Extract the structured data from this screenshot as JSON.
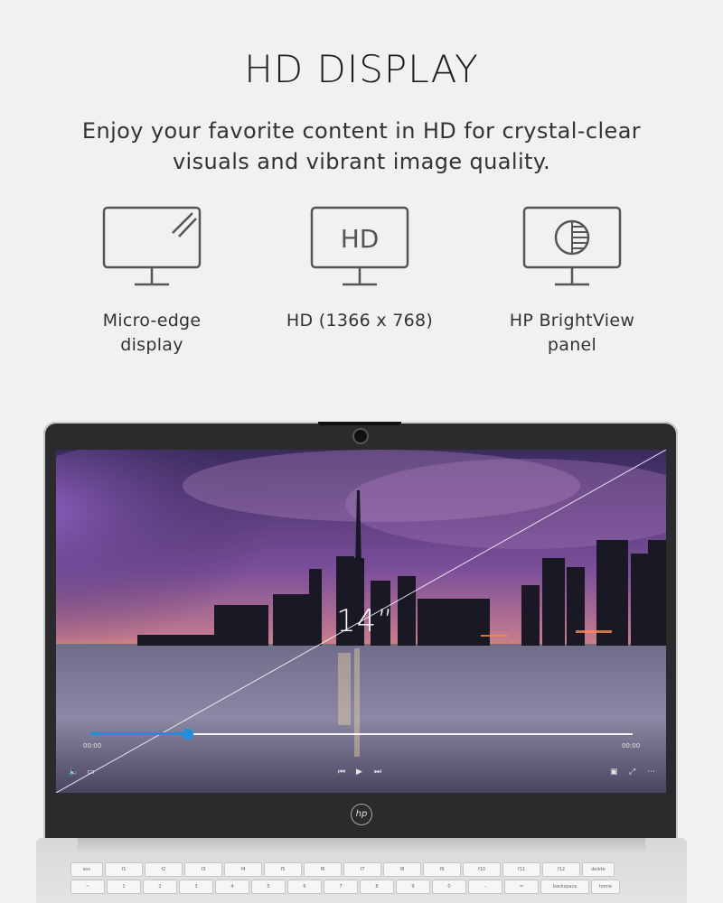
{
  "header": {
    "title": "HD DISPLAY",
    "subtitle_line1": "Enjoy your favorite content in HD for crystal-clear",
    "subtitle_line2": "visuals and vibrant image quality."
  },
  "features": [
    {
      "icon": "monitor-micro-edge-icon",
      "label_line1": "Micro-edge",
      "label_line2": "display"
    },
    {
      "icon": "monitor-hd-icon",
      "icon_text": "HD",
      "label_line1": "HD (1366 x 768)",
      "label_line2": ""
    },
    {
      "icon": "monitor-brightview-icon",
      "label_line1": "HP BrightView",
      "label_line2": "panel"
    }
  ],
  "screen": {
    "size_label": "14”",
    "player": {
      "time_current": "00:00",
      "time_total": "00:00",
      "progress": 0.18
    }
  },
  "laptop": {
    "brand_logo": "hp",
    "keys_row1": [
      "esc",
      "f1",
      "f2",
      "f3",
      "f4",
      "f5",
      "f6",
      "f7",
      "f8",
      "f9",
      "f10",
      "f11",
      "f12",
      "delete"
    ],
    "keys_row2": [
      "~",
      "1",
      "2",
      "3",
      "4",
      "5",
      "6",
      "7",
      "8",
      "9",
      "0",
      "-",
      "=",
      "backspace",
      "home"
    ]
  },
  "colors": {
    "background": "#f1f1f1",
    "icon_stroke": "#555555",
    "accent": "#1f90d8"
  }
}
